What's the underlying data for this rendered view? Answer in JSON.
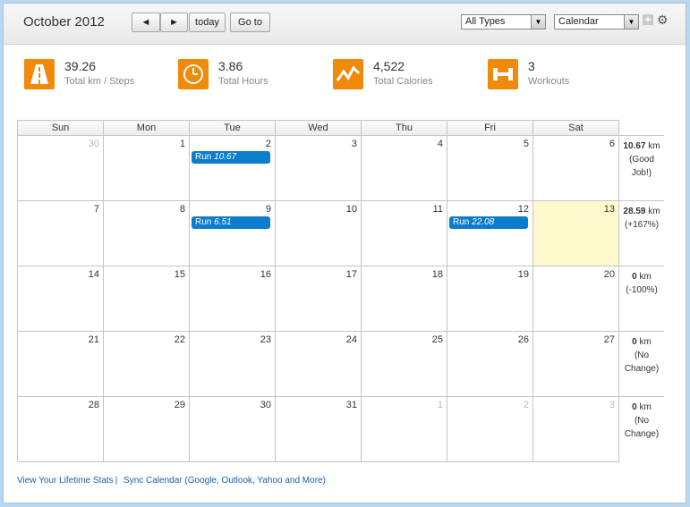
{
  "header": {
    "month_title": "October 2012",
    "prev_label": "◄",
    "next_label": "►",
    "today_label": "today",
    "goto_label": "Go to",
    "type_filter": "All Types",
    "view_select": "Calendar"
  },
  "stats": [
    {
      "value": "39.26",
      "label": "Total km / Steps",
      "icon": "road-icon"
    },
    {
      "value": "3.86",
      "label": "Total Hours",
      "icon": "clock-icon"
    },
    {
      "value": "4,522",
      "label": "Total Calories",
      "icon": "calories-icon"
    },
    {
      "value": "3",
      "label": "Workouts",
      "icon": "dumbbell-icon"
    }
  ],
  "calendar": {
    "weekdays": [
      "Sun",
      "Mon",
      "Tue",
      "Wed",
      "Thu",
      "Fri",
      "Sat"
    ],
    "weeks": [
      {
        "days": [
          "30",
          "1",
          "2",
          "3",
          "4",
          "5",
          "6"
        ],
        "summary_value": "10.67",
        "summary_unit": " km",
        "summary_note": "(Good Job!)"
      },
      {
        "days": [
          "7",
          "8",
          "9",
          "10",
          "11",
          "12",
          "13"
        ],
        "summary_value": "28.59",
        "summary_unit": " km",
        "summary_note": "(+167%)"
      },
      {
        "days": [
          "14",
          "15",
          "16",
          "17",
          "18",
          "19",
          "20"
        ],
        "summary_value": "0",
        "summary_unit": " km",
        "summary_note": "(-100%)"
      },
      {
        "days": [
          "21",
          "22",
          "23",
          "24",
          "25",
          "26",
          "27"
        ],
        "summary_value": "0",
        "summary_unit": " km",
        "summary_note": "(No Change)"
      },
      {
        "days": [
          "28",
          "29",
          "30",
          "31",
          "1",
          "2",
          "3"
        ],
        "summary_value": "0",
        "summary_unit": " km",
        "summary_note": "(No Change)"
      }
    ],
    "events": {
      "w0_tue": {
        "type": "Run",
        "value": "10.67"
      },
      "w1_tue": {
        "type": "Run",
        "value": "6.51"
      },
      "w1_fri": {
        "type": "Run",
        "value": "22.08"
      }
    }
  },
  "footer": {
    "lifetime_link": "View Your Lifetime Stats",
    "separator": "|",
    "sync_link": "Sync Calendar (Google, Outlook, Yahoo and More)"
  },
  "colors": {
    "accent": "#f08a0a",
    "event": "#0c7ccd",
    "today": "#fffacd",
    "link": "#1a5fa8"
  }
}
